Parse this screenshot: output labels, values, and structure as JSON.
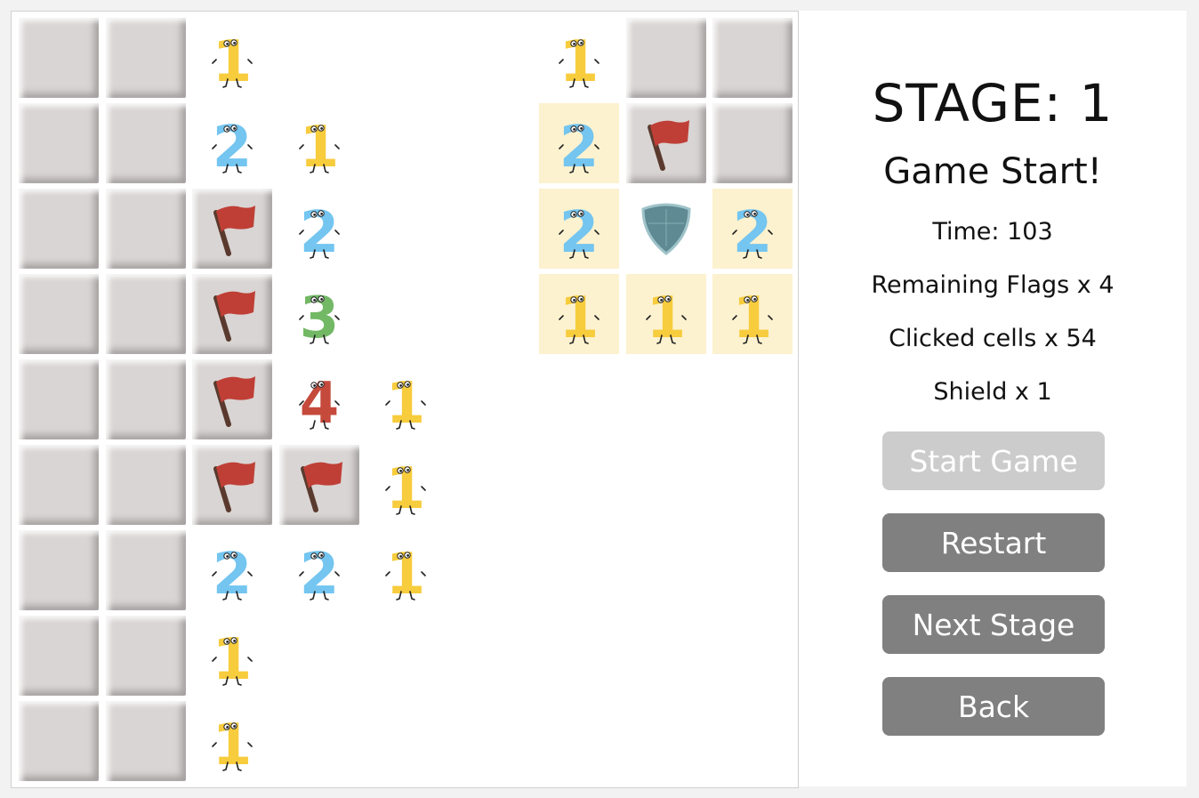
{
  "stage": {
    "label": "STAGE: 1"
  },
  "status": "Game Start!",
  "info": {
    "time": "Time: 103",
    "flags": "Remaining Flags x 4",
    "clicked": "Clicked cells x 54",
    "shield": "Shield x 1"
  },
  "buttons": {
    "start": "Start Game",
    "restart": "Restart",
    "next": "Next Stage",
    "back": "Back"
  },
  "colors": {
    "1": "#f7cc3d",
    "2": "#74c5f0",
    "3": "#72b865",
    "4": "#c54a3c",
    "flag": "#bf3f36",
    "pole": "#5a3a2e",
    "shield": "#5f8a93",
    "highlight": "#fdf2cf"
  },
  "board": [
    [
      "C",
      "C",
      "1",
      "E",
      "E",
      "E",
      "1",
      "C",
      "C"
    ],
    [
      "C",
      "C",
      "2",
      "1",
      "E",
      "E",
      "2h",
      "F",
      "C"
    ],
    [
      "C",
      "C",
      "F",
      "2",
      "E",
      "E",
      "2h",
      "S",
      "2h"
    ],
    [
      "C",
      "C",
      "F",
      "3",
      "E",
      "E",
      "1h",
      "1h",
      "1h"
    ],
    [
      "C",
      "C",
      "F",
      "4",
      "1",
      "E",
      "E",
      "E",
      "E"
    ],
    [
      "C",
      "C",
      "F",
      "F",
      "1",
      "E",
      "E",
      "E",
      "E"
    ],
    [
      "C",
      "C",
      "2",
      "2",
      "1",
      "E",
      "E",
      "E",
      "E"
    ],
    [
      "C",
      "C",
      "1",
      "E",
      "E",
      "E",
      "E",
      "E",
      "E"
    ],
    [
      "C",
      "C",
      "1",
      "E",
      "E",
      "E",
      "E",
      "E",
      "E"
    ]
  ]
}
